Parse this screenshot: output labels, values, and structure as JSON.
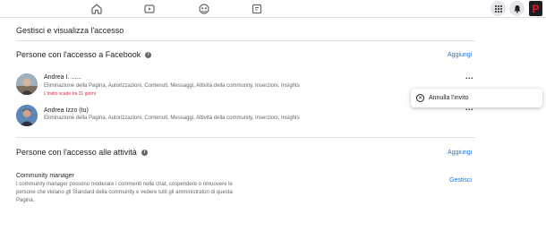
{
  "topbar": {
    "nav_icons": [
      "home-icon",
      "watch-icon",
      "groups-icon",
      "pages-icon"
    ],
    "right_icons": [
      "menu-grid-icon",
      "notifications-icon"
    ],
    "brand_letter": "P",
    "brand_color": "#e41b23"
  },
  "page": {
    "title": "Gestisci e visualizza l'accesso"
  },
  "facebook_access": {
    "title": "Persone con l'accesso a Facebook",
    "add_label": "Aggiungi",
    "people": [
      {
        "name": "Andrea I. ......",
        "permissions": "Eliminazione della Pagina, Autorizzazioni, Contenuti, Messaggi, Attività della community, Inserzioni, Insights",
        "status": "L'invito scade tra 31 giorni",
        "more": "..."
      },
      {
        "name": "Andrea Izzo (tu)",
        "permissions": "Eliminazione della Pagina, Autorizzazioni, Contenuti, Messaggi, Attività della community, Inserzioni, Insights",
        "more": "..."
      }
    ],
    "popup_menu": {
      "item_label": "Annulla l'invito"
    }
  },
  "activity_access": {
    "title": "Persone con l'accesso alle attività",
    "add_label": "Aggiungi",
    "roles": [
      {
        "title": "Community manager",
        "description": "I community manager possono moderare i commenti nelle chat, sospendere o rimuovere le persone che violano gli Standard della community e vedere tutti gli amministratori di questa Pagina.",
        "action_label": "Gestisci"
      }
    ]
  },
  "colors": {
    "accent": "#1b74e4",
    "warning": "#e41e3f",
    "text": "#1c1e21",
    "secondary": "#65676b"
  }
}
